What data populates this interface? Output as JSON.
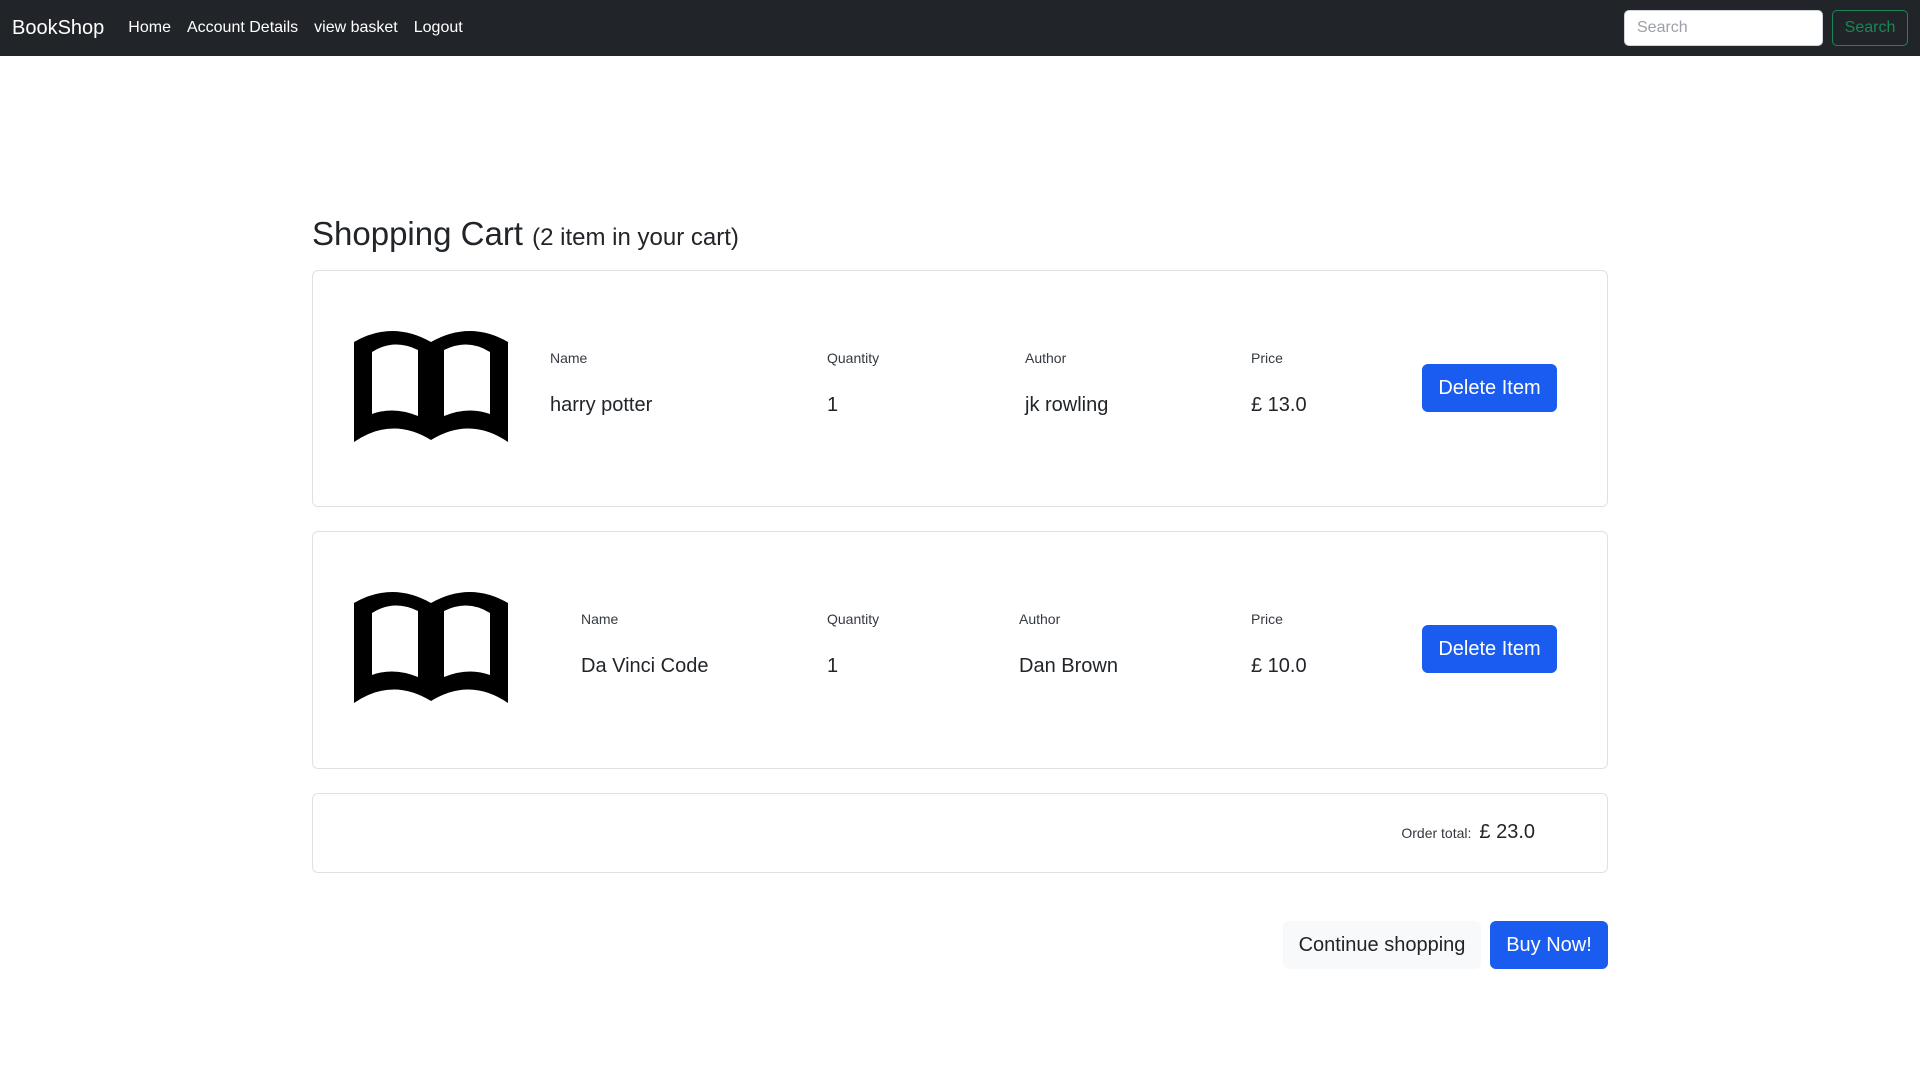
{
  "navbar": {
    "brand": "BookShop",
    "links": [
      "Home",
      "Account Details",
      "view basket",
      "Logout"
    ],
    "search_placeholder": "Search",
    "search_button": "Search"
  },
  "cart": {
    "title": "Shopping Cart",
    "count_text": "(2 item in your cart)",
    "column_labels": {
      "name": "Name",
      "quantity": "Quantity",
      "author": "Author",
      "price": "Price"
    },
    "items": [
      {
        "name": "harry potter",
        "quantity": "1",
        "author": "jk rowling",
        "price": "£ 13.0",
        "delete_label": "Delete Item",
        "icon": "book-icon"
      },
      {
        "name": "Da Vinci Code",
        "quantity": "1",
        "author": "Dan Brown",
        "price": "£ 10.0",
        "delete_label": "Delete Item",
        "icon": "book-icon"
      }
    ],
    "total_label": "Order total:",
    "total_value": "£ 23.0"
  },
  "actions": {
    "continue_label": "Continue shopping",
    "buy_label": "Buy Now!"
  },
  "colors": {
    "navbar_bg": "#212529",
    "primary": "#1a5bf0",
    "success": "#198754",
    "border": "#dee2e6"
  }
}
